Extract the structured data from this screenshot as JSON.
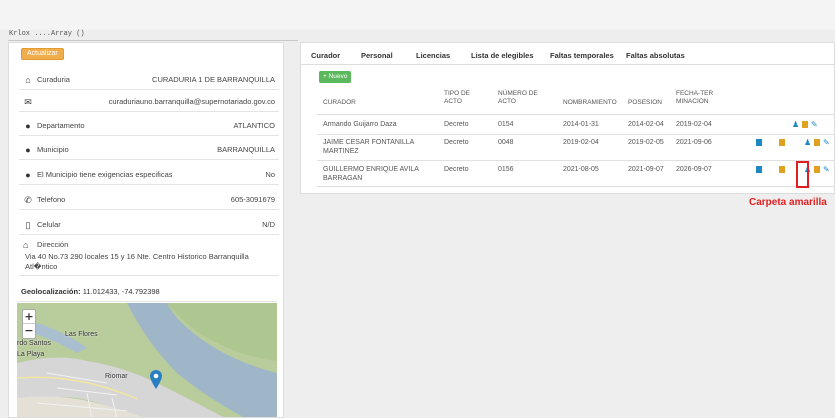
{
  "debug_text": "Krlox ....Array ()",
  "info": {
    "update_button": "Actualizar",
    "rows": [
      {
        "icon": "home-icon",
        "label": "Curaduria",
        "value": "CURADURIA 1 DE BARRANQUILLA"
      },
      {
        "icon": "envelope-icon",
        "label": "",
        "value": "curaduriauno.barranquilla@supernotariado.gov.co"
      },
      {
        "icon": "map-marker-icon",
        "label": "Departamento",
        "value": "ATLANTICO"
      },
      {
        "icon": "map-marker-icon",
        "label": "Municipio",
        "value": "BARRANQUILLA"
      },
      {
        "icon": "map-marker-icon",
        "label": "El Municipio tiene exigencias especificas",
        "value": "No"
      },
      {
        "icon": "phone-icon",
        "label": "Telefono",
        "value": "605-3091679"
      },
      {
        "icon": "mobile-icon",
        "label": "Celular",
        "value": "N/D"
      }
    ],
    "direccion_label": "Dirección",
    "direccion_value": "Via 40 No.73 290 locales 15 y 16 Nte. Centro Historico Barranquilla Atl�ntico",
    "geo_label": "Geolocalización:",
    "geo_value": "11.012433, -74.792398"
  },
  "map": {
    "labels": [
      "rdo Santos",
      "La Playa",
      "Las Flores",
      "Riomar"
    ],
    "zoom_in": "+",
    "zoom_out": "−"
  },
  "tabs": [
    "Curador",
    "Personal",
    "Licencias",
    "Lista de elegibles",
    "Faltas temporales",
    "Faltas absolutas"
  ],
  "new_button": "+ Nuevo",
  "table": {
    "headers": [
      "CURADOR",
      "TIPO DE ACTO",
      "NÚMERO DE ACTO",
      "NOMBRAMIENTO",
      "POSESION",
      "FECHA-TERMINACION"
    ],
    "rows": [
      {
        "curador": "Armando Guijarro Daza",
        "tipo": "Decreto",
        "numero": "0154",
        "nombramiento": "2014-01-31",
        "posesion": "2014-02-04",
        "terminacion": "2019-02-04"
      },
      {
        "curador": "JAIME CESAR FONTANILLA MARTINEZ",
        "tipo": "Decreto",
        "numero": "0048",
        "nombramiento": "2019-02-04",
        "posesion": "2019-02-05",
        "terminacion": "2021-09-06"
      },
      {
        "curador": "GUILLERMO ENRIQUE AVILA BARRAGAN",
        "tipo": "Decreto",
        "numero": "0156",
        "nombramiento": "2021-08-05",
        "posesion": "2021-09-07",
        "terminacion": "2026-09-07"
      }
    ]
  },
  "annotation": "Carpeta amarilla",
  "colors": {
    "accent_red": "#e02020",
    "folder": "#e0a020",
    "file": "#1e88c7",
    "green": "#5cb85c",
    "orange": "#f0ad4e"
  }
}
